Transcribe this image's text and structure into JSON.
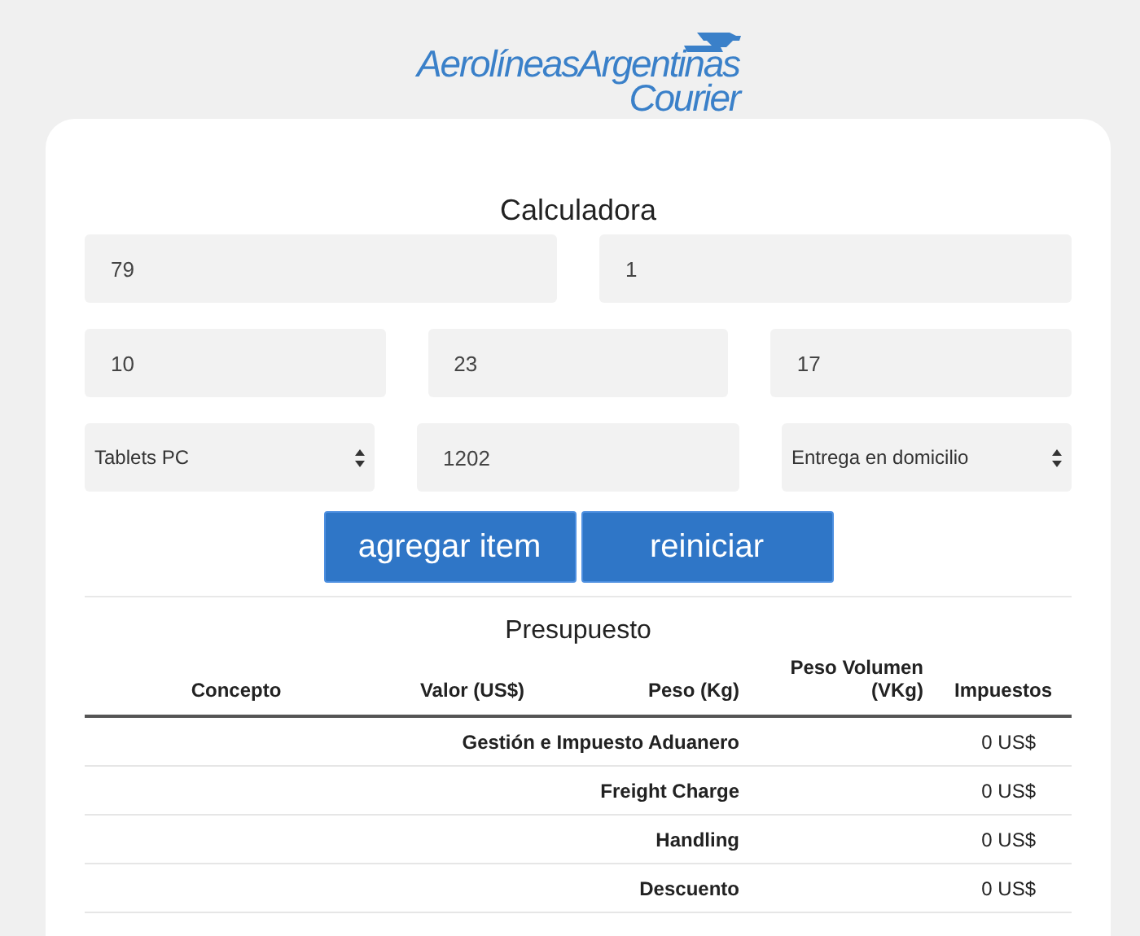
{
  "logo": {
    "line_1": "AerolíneasArgentinas",
    "line_2": "Courier"
  },
  "calculator": {
    "title": "Calculadora",
    "rows": [
      [
        {
          "kind": "input",
          "value": "79"
        },
        {
          "kind": "input",
          "value": "1"
        }
      ],
      [
        {
          "kind": "input",
          "value": "10"
        },
        {
          "kind": "input",
          "value": "23"
        },
        {
          "kind": "input",
          "value": "17"
        }
      ],
      [
        {
          "kind": "select",
          "value": "Tablets PC"
        },
        {
          "kind": "input",
          "value": "1202"
        },
        {
          "kind": "select",
          "value": "Entrega en domicilio"
        }
      ]
    ],
    "buttons": [
      "agregar item",
      "reiniciar"
    ]
  },
  "budget": {
    "title": "Presupuesto",
    "columns": [
      "Concepto",
      "Valor (US$)",
      "Peso (Kg)",
      "Peso Volumen (VKg)",
      "Impuestos"
    ],
    "rows": [
      {
        "concept": "Gestión e Impuesto Aduanero",
        "amount": "0 US$"
      },
      {
        "concept": "Freight Charge",
        "amount": "0 US$"
      },
      {
        "concept": "Handling",
        "amount": "0 US$"
      },
      {
        "concept": "Descuento",
        "amount": "0 US$"
      }
    ]
  }
}
